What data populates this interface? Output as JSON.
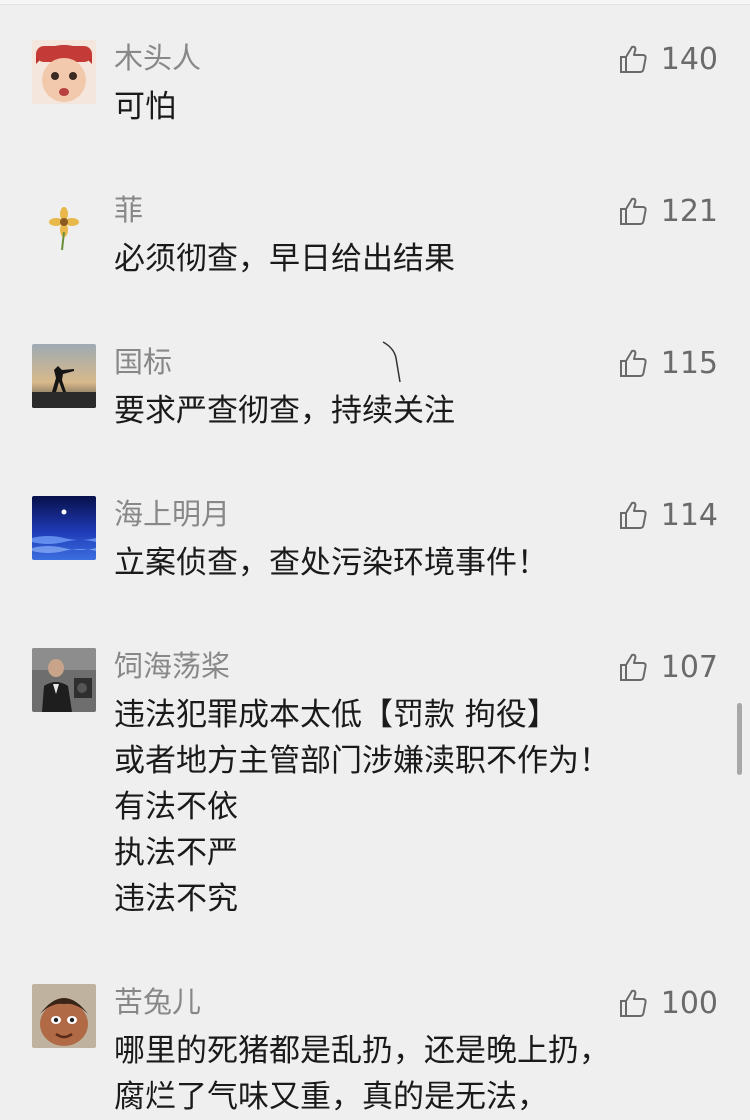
{
  "comments": [
    {
      "username": "木头人",
      "likes": "140",
      "avatar_icon": "baby-avatar",
      "lines": [
        "可怕"
      ]
    },
    {
      "username": "菲",
      "likes": "121",
      "avatar_icon": "flower-avatar",
      "lines": [
        "必须彻查，早日给出结果"
      ]
    },
    {
      "username": "国标",
      "likes": "115",
      "avatar_icon": "silhouette-avatar",
      "lines": [
        "要求严查彻查，持续关注"
      ]
    },
    {
      "username": "海上明月",
      "likes": "114",
      "avatar_icon": "moon-sea-avatar",
      "lines": [
        "立案侦查，查处污染环境事件！"
      ]
    },
    {
      "username": "饲海荡桨",
      "likes": "107",
      "avatar_icon": "person-photo-avatar",
      "lines": [
        "违法犯罪成本太低【罚款  拘役】",
        "或者地方主管部门涉嫌渎职不作为！",
        "有法不依",
        "执法不严",
        "违法不究"
      ]
    },
    {
      "username": "苦兔儿",
      "likes": "100",
      "avatar_icon": "cartoon-avatar",
      "lines": [
        "哪里的死猪都是乱扔，还是晚上扔，",
        "腐烂了气味又重，真的是无法，"
      ]
    }
  ],
  "icons": {
    "like": "thumbs-up-icon"
  },
  "colors": {
    "background": "#efefef",
    "username": "#888888",
    "text": "#1a1a1a",
    "like_count": "#6a6a6a"
  }
}
